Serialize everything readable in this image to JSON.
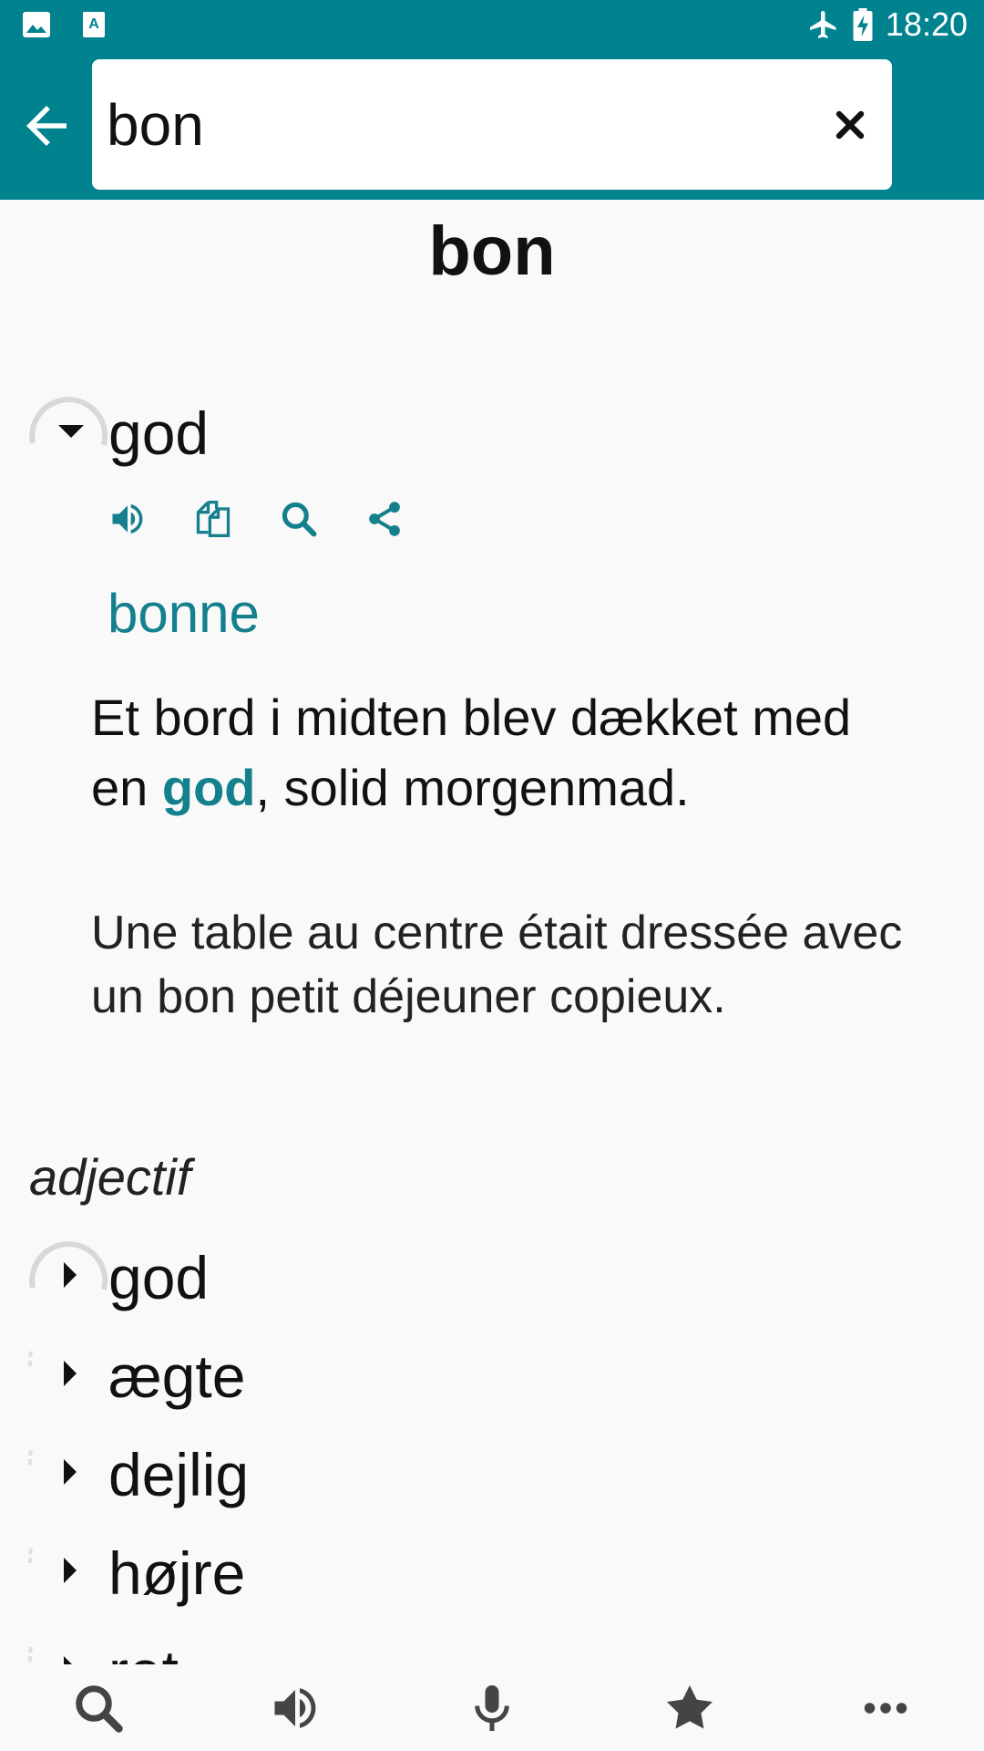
{
  "status_bar": {
    "time": "18:20",
    "icons": [
      "image-icon",
      "text-a-icon",
      "airplane-icon",
      "battery-charging-icon"
    ]
  },
  "search": {
    "value": "bon",
    "back_icon": "arrow-left-icon",
    "clear_icon": "close-icon"
  },
  "entry": {
    "headword": "bon",
    "first_sense": {
      "term": "god",
      "actions": [
        "speaker-icon",
        "copy-icon",
        "search-icon",
        "share-icon"
      ],
      "feminine": "bonne",
      "example_before": "Et bord i midten blev dækket med en ",
      "example_highlight": "god",
      "example_after": ", solid morgenmad.",
      "translation": "Une table au centre était dressée avec un bon petit déjeuner copieux."
    },
    "pos": "adjectif",
    "senses": [
      "god",
      "ægte",
      "dejlig",
      "højre",
      "ret"
    ]
  },
  "bottom_nav": [
    "search-icon",
    "speaker-icon",
    "microphone-icon",
    "star-icon",
    "more-icon"
  ],
  "colors": {
    "primary": "#00838f",
    "accent": "#14808d"
  }
}
